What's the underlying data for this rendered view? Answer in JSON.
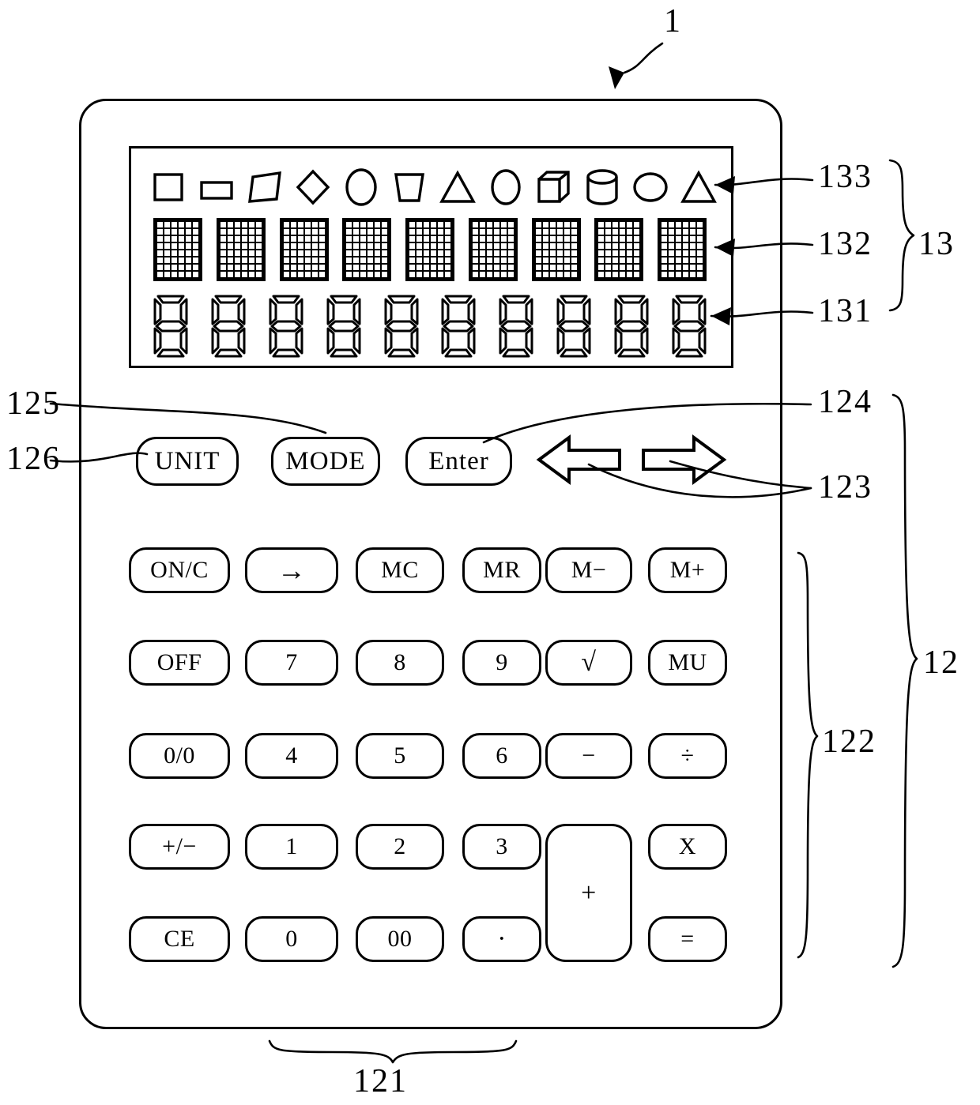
{
  "figure": {
    "device_label": "1",
    "bottom_label": "121"
  },
  "display": {
    "group_label": "13",
    "shape_row_label": "133",
    "matrix_row_label": "132",
    "segment_row_label": "131",
    "shapes": [
      {
        "name": "square",
        "icon": "square"
      },
      {
        "name": "rectangle",
        "icon": "rectangle"
      },
      {
        "name": "parallelogram",
        "icon": "parallelogram"
      },
      {
        "name": "diamond",
        "icon": "diamond"
      },
      {
        "name": "ellipse-tall",
        "icon": "ellipse-tall"
      },
      {
        "name": "trapezoid",
        "icon": "trapezoid"
      },
      {
        "name": "triangle",
        "icon": "triangle"
      },
      {
        "name": "ellipse",
        "icon": "ellipse"
      },
      {
        "name": "cube",
        "icon": "cube"
      },
      {
        "name": "cylinder",
        "icon": "cylinder"
      },
      {
        "name": "circle",
        "icon": "circle"
      },
      {
        "name": "triangle-2",
        "icon": "triangle"
      }
    ],
    "matrix_count": 9,
    "matrix_cols": 6,
    "matrix_rows": 8,
    "segment_count": 10,
    "segment_digit": "8"
  },
  "controls": {
    "group_label": "12",
    "keypad_label": "122",
    "unit": {
      "label": "UNIT",
      "ref": "126"
    },
    "mode": {
      "label": "MODE",
      "ref": "125"
    },
    "enter": {
      "label": "Enter",
      "ref": "124"
    },
    "arrows": {
      "ref": "123",
      "left": "left-arrow",
      "right": "right-arrow"
    }
  },
  "keypad": {
    "rows": [
      [
        {
          "label": "ON/C",
          "name": "on-clear"
        },
        {
          "label": "→",
          "name": "backspace-arrow"
        },
        {
          "label": "MC",
          "name": "memory-clear"
        },
        {
          "label": "MR",
          "name": "memory-recall"
        },
        {
          "label": "M−",
          "name": "memory-minus"
        },
        {
          "label": "M+",
          "name": "memory-plus"
        }
      ],
      [
        {
          "label": "OFF",
          "name": "off"
        },
        {
          "label": "7",
          "name": "digit-7"
        },
        {
          "label": "8",
          "name": "digit-8"
        },
        {
          "label": "9",
          "name": "digit-9"
        },
        {
          "label": "√",
          "name": "square-root"
        },
        {
          "label": "MU",
          "name": "markup"
        }
      ],
      [
        {
          "label": "0/0",
          "name": "percent"
        },
        {
          "label": "4",
          "name": "digit-4"
        },
        {
          "label": "5",
          "name": "digit-5"
        },
        {
          "label": "6",
          "name": "digit-6"
        },
        {
          "label": "−",
          "name": "minus"
        },
        {
          "label": "÷",
          "name": "divide"
        }
      ],
      [
        {
          "label": "+/−",
          "name": "sign-change"
        },
        {
          "label": "1",
          "name": "digit-1"
        },
        {
          "label": "2",
          "name": "digit-2"
        },
        {
          "label": "3",
          "name": "digit-3"
        },
        {
          "label": "+",
          "name": "plus"
        },
        {
          "label": "X",
          "name": "multiply"
        }
      ],
      [
        {
          "label": "CE",
          "name": "clear-entry"
        },
        {
          "label": "0",
          "name": "digit-0"
        },
        {
          "label": "00",
          "name": "digit-double-zero"
        },
        {
          "label": "·",
          "name": "decimal-point"
        },
        {
          "label": "=",
          "name": "equals"
        }
      ]
    ]
  }
}
